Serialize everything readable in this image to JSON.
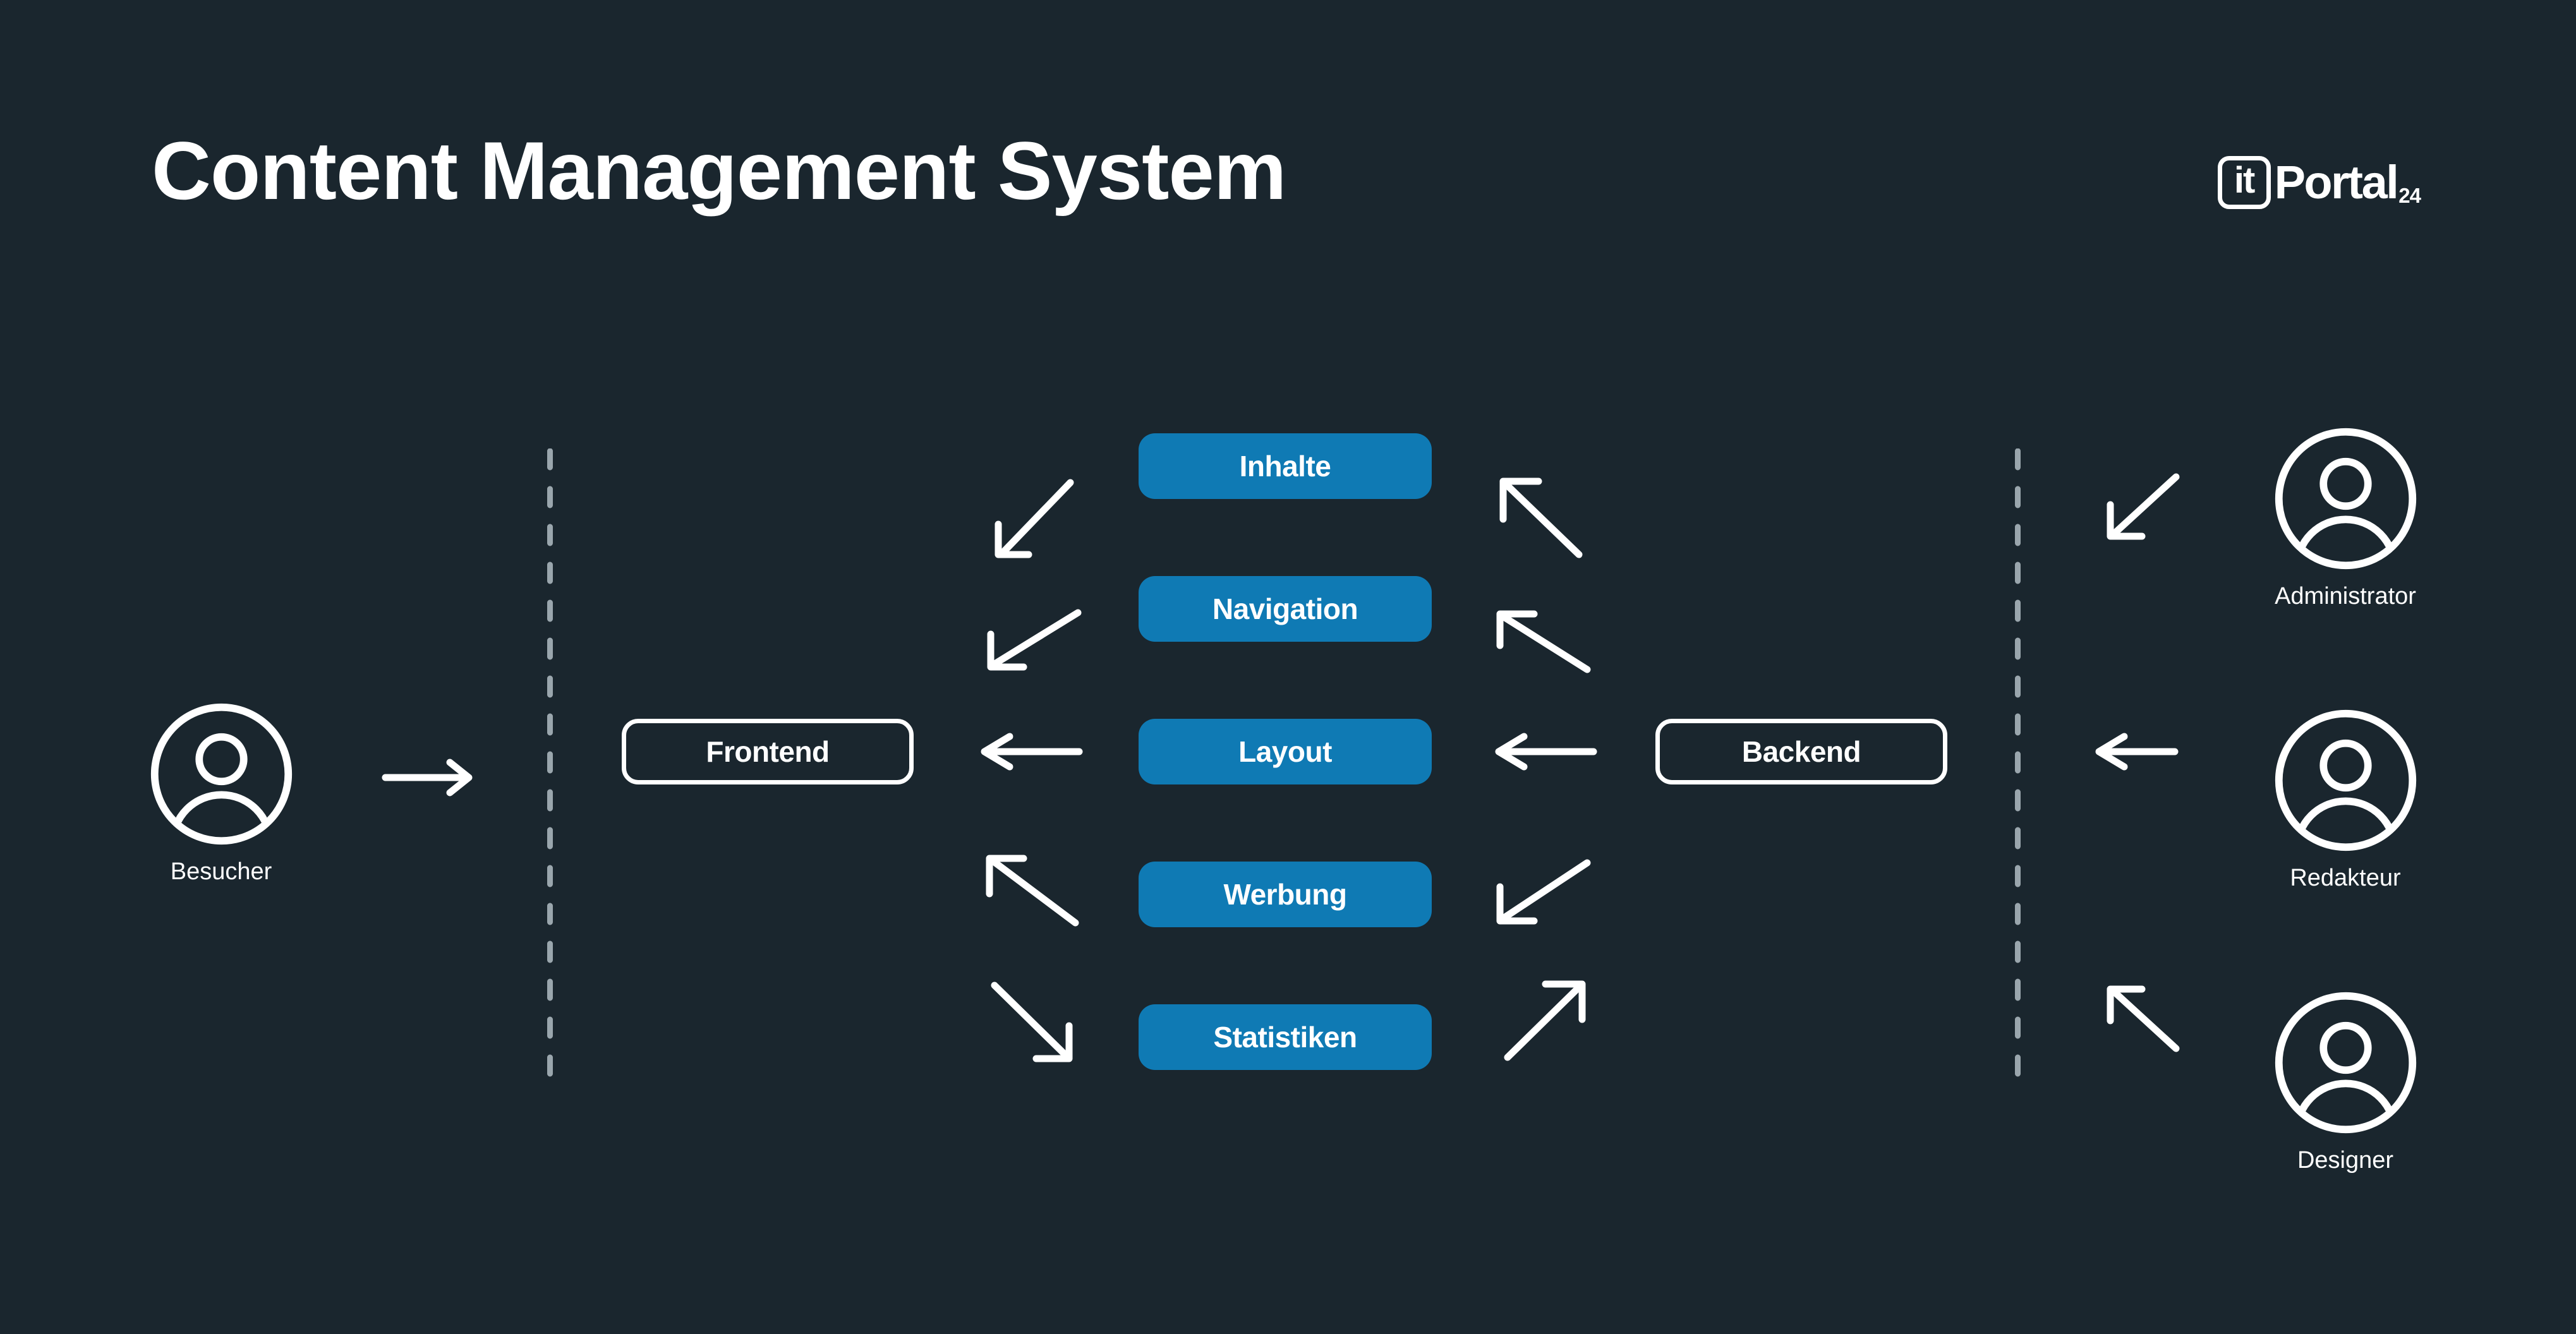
{
  "page": {
    "title": "Content Management System",
    "background_color": "#1a262e",
    "accent_color": "#0f7ab4",
    "line_color": "#ffffff",
    "divider_color": "#9aa6ad"
  },
  "brand": {
    "mark_text": "it",
    "word": "Portal",
    "sub": "24"
  },
  "actors": {
    "visitor": {
      "label": "Besucher",
      "icon": "user-circle-icon"
    },
    "administrator": {
      "label": "Administrator",
      "icon": "user-circle-icon"
    },
    "editor": {
      "label": "Redakteur",
      "icon": "user-circle-icon"
    },
    "designer": {
      "label": "Designer",
      "icon": "user-circle-icon"
    }
  },
  "nodes": {
    "frontend": {
      "label": "Frontend",
      "style": "outline"
    },
    "backend": {
      "label": "Backend",
      "style": "outline"
    },
    "modules": [
      {
        "label": "Inhalte",
        "style": "filled"
      },
      {
        "label": "Navigation",
        "style": "filled"
      },
      {
        "label": "Layout",
        "style": "filled"
      },
      {
        "label": "Werbung",
        "style": "filled"
      },
      {
        "label": "Statistiken",
        "style": "filled"
      }
    ]
  },
  "connections": [
    {
      "from": "Besucher",
      "to": "Frontend",
      "direction": "right"
    },
    {
      "from": "Inhalte",
      "to": "Frontend",
      "direction": "down-left"
    },
    {
      "from": "Navigation",
      "to": "Frontend",
      "direction": "down-left"
    },
    {
      "from": "Layout",
      "to": "Frontend",
      "direction": "left"
    },
    {
      "from": "Werbung",
      "to": "Frontend",
      "direction": "up-left"
    },
    {
      "from": "Statistiken",
      "to": "Frontend",
      "direction": "down-right"
    },
    {
      "from": "Backend",
      "to": "Inhalte",
      "direction": "up-left"
    },
    {
      "from": "Backend",
      "to": "Navigation",
      "direction": "up-left"
    },
    {
      "from": "Backend",
      "to": "Layout",
      "direction": "left"
    },
    {
      "from": "Backend",
      "to": "Werbung",
      "direction": "down-left"
    },
    {
      "from": "Backend",
      "to": "Statistiken",
      "direction": "up-right"
    },
    {
      "from": "Administrator",
      "to": "Backend",
      "direction": "down-left"
    },
    {
      "from": "Redakteur",
      "to": "Backend",
      "direction": "left"
    },
    {
      "from": "Designer",
      "to": "Backend",
      "direction": "up-left"
    }
  ],
  "dividers": [
    {
      "name": "frontend-boundary"
    },
    {
      "name": "backend-boundary"
    }
  ]
}
